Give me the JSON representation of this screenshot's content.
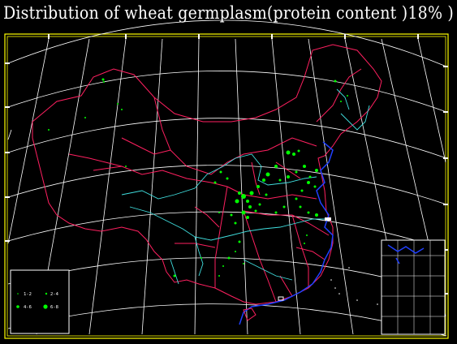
{
  "title": "Distribution of wheat germplasm(protein content )18% )",
  "legend": {
    "entries": [
      {
        "label": "1-2",
        "marker": "tiny-dot"
      },
      {
        "label": "2-4",
        "marker": "small-dot"
      },
      {
        "label": "4-6",
        "marker": "medium-dot"
      },
      {
        "label": "6-8",
        "marker": "large-dot"
      }
    ]
  },
  "colors": {
    "background": "#000000",
    "frame": "#ffff00",
    "graticule": "#ffffff",
    "borders": "#ff2060",
    "rivers": "#40e0e0",
    "coast": "#2040ff",
    "markers": "#00ff00"
  }
}
